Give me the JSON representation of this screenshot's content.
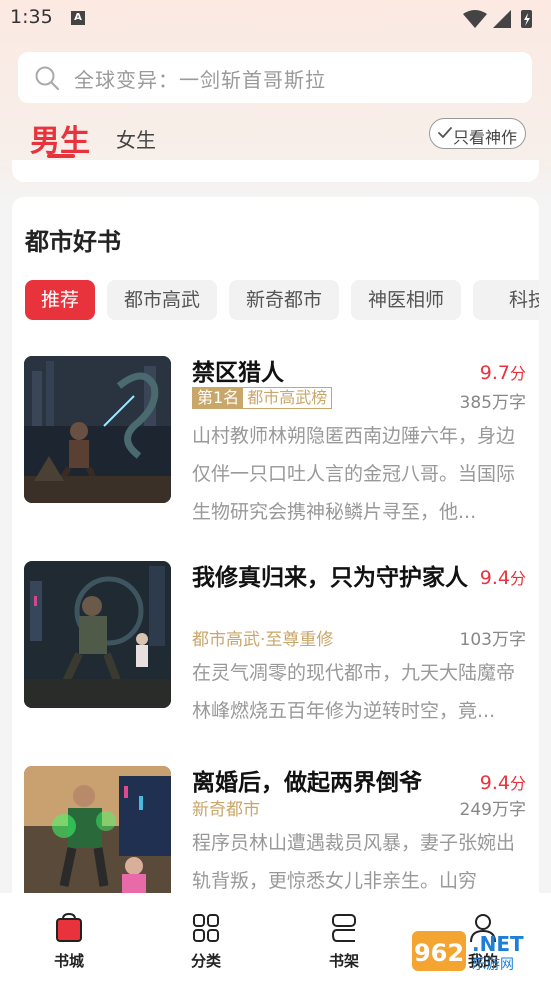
{
  "status_bar": {
    "time": "1:35",
    "notification_icon": "A"
  },
  "search": {
    "placeholder": "全球变异：一剑斩首哥斯拉"
  },
  "gender_tabs": {
    "male": "男生",
    "female": "女生",
    "active": "male"
  },
  "filter": {
    "label": "只看神作"
  },
  "section": {
    "title": "都市好书",
    "chips": [
      "推荐",
      "都市高武",
      "新奇都市",
      "神医相师",
      "科技"
    ],
    "active_chip": 0
  },
  "books": [
    {
      "title": "禁区猎人",
      "score": "9.7",
      "score_unit": "分",
      "rank_label": "第1名",
      "rank_list": "都市高武榜",
      "words": "385万字",
      "description": "山村教师林朔隐匿西南边陲六年，身边仅伴一只口吐人言的金冠八哥。当国际生物研究会携神秘鳞片寻至，他..."
    },
    {
      "title": "我修真归来，只为守护家人",
      "score": "9.4",
      "score_unit": "分",
      "tags": "都市高武·至尊重修",
      "words": "103万字",
      "description": "在灵气凋零的现代都市，九天大陆魔帝林峰燃烧五百年修为逆转时空，竟..."
    },
    {
      "title": "离婚后，做起两界倒爷",
      "score": "9.4",
      "score_unit": "分",
      "tags": "新奇都市",
      "words": "249万字",
      "description": "程序员林山遭遇裁员风暴，妻子张婉出轨背叛，更惊悉女儿非亲生。山穷"
    }
  ],
  "bottom_nav": [
    {
      "label": "书城",
      "icon": "bookstore-icon",
      "active": true
    },
    {
      "label": "分类",
      "icon": "grid-icon",
      "active": false
    },
    {
      "label": "书架",
      "icon": "bookshelf-icon",
      "active": false
    },
    {
      "label": "我的",
      "icon": "profile-icon",
      "active": false
    }
  ],
  "watermark": {
    "text": "962.NET",
    "subtext": "乐游网"
  },
  "colors": {
    "accent": "#e8333c",
    "gold": "#c9a66a"
  }
}
